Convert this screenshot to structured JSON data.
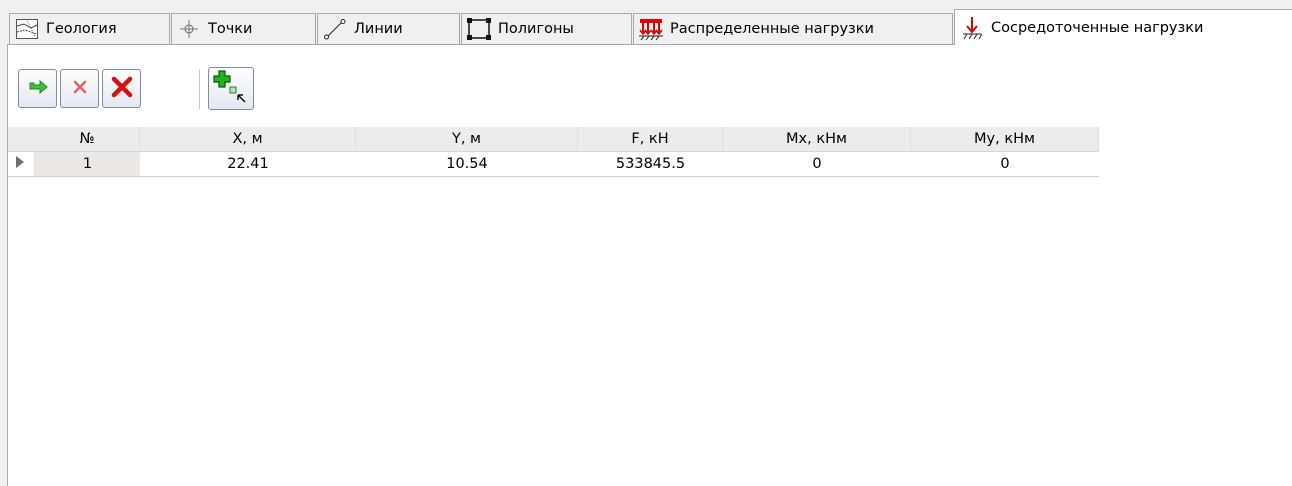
{
  "tabs": [
    {
      "label": "Геология",
      "icon": "geology-icon"
    },
    {
      "label": "Точки",
      "icon": "point-icon"
    },
    {
      "label": "Линии",
      "icon": "line-icon"
    },
    {
      "label": "Полигоны",
      "icon": "polygon-icon"
    },
    {
      "label": "Распределенные нагрузки",
      "icon": "distributed-load-icon"
    },
    {
      "label": "Сосредоточенные нагрузки",
      "icon": "point-load-icon",
      "active": true
    }
  ],
  "toolbar": {
    "buttons": [
      "apply-arrow-icon",
      "delete-icon",
      "delete-all-icon",
      "add-point-icon"
    ]
  },
  "grid": {
    "columns": [
      "№",
      "X, м",
      "Y, м",
      "F, кН",
      "Mx, кНм",
      "My, кНм"
    ],
    "rows": [
      [
        "1",
        "22.41",
        "10.54",
        "533845.5",
        "0",
        "0"
      ]
    ]
  },
  "colors": {
    "tab_border": "#a9a9a9",
    "window_bg": "#f0f0f0",
    "load_red": "#e00000",
    "add_green": "#00a000"
  }
}
